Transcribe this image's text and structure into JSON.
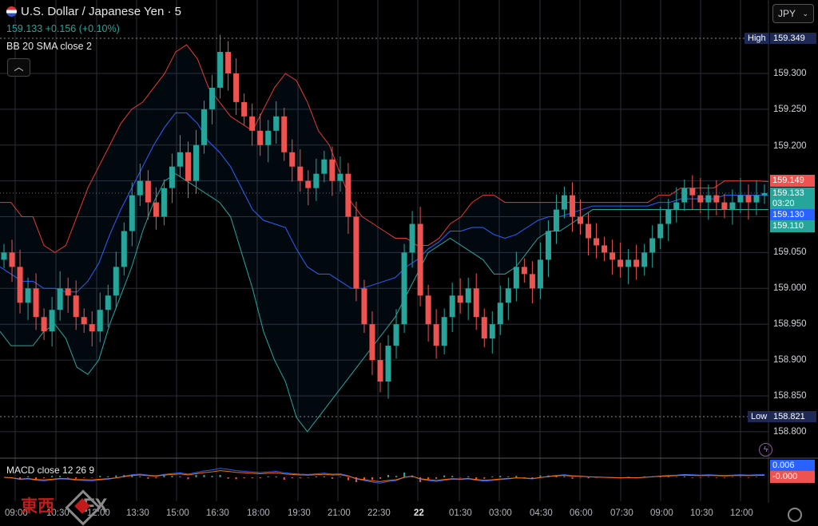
{
  "header": {
    "symbol_title": "U.S. Dollar / Japanese Yen · 5",
    "price_line": "159.133  +0.156 (+0.10%)",
    "indicator": "BB 20 SMA close 2",
    "collapse_icon": "chevron-up-icon"
  },
  "currency_select": {
    "value": "JPY",
    "icon": "chevron-down-icon"
  },
  "price_axis": {
    "labels": [
      "159.300",
      "159.250",
      "159.200",
      "159.050",
      "159.000",
      "158.950",
      "158.900",
      "158.850",
      "158.800"
    ],
    "high": {
      "label": "High",
      "value": "159.349"
    },
    "low": {
      "label": "Low",
      "value": "158.821"
    },
    "bb_upper": "159.149",
    "last_price": "159.133",
    "countdown": "03:20",
    "sma_value": "159.130",
    "bb_lower": "159.110"
  },
  "macd": {
    "label": "MACD close 12 26 9",
    "macd_value": "0.006",
    "signal_value": "-0.000"
  },
  "time_axis": {
    "labels": [
      "09:00",
      "10:30",
      "12:00",
      "13:30",
      "15:00",
      "16:30",
      "18:00",
      "19:30",
      "21:00",
      "22:30",
      "22",
      "01:30",
      "03:00",
      "04:30",
      "06:00",
      "07:30",
      "09:00",
      "10:30",
      "12:00"
    ]
  },
  "watermark": {
    "cn_text": "東西",
    "fx_text": "FX"
  },
  "colors": {
    "up": "#26a69a",
    "down": "#ef5350",
    "bb_upper": "#e53935",
    "bb_lower": "#26a69a",
    "sma": "#2962ff",
    "background": "#000000",
    "grid": "#2a2e39"
  },
  "chart_data": {
    "type": "candlestick",
    "ylim": [
      158.78,
      159.375
    ],
    "series": [
      {
        "name": "close",
        "values": [
          159.05,
          159.03,
          158.98,
          159.0,
          158.96,
          158.94,
          158.97,
          159.0,
          158.99,
          158.96,
          158.95,
          158.94,
          158.97,
          158.99,
          159.03,
          159.08,
          159.13,
          159.15,
          159.12,
          159.1,
          159.14,
          159.17,
          159.19,
          159.15,
          159.2,
          159.25,
          159.28,
          159.33,
          159.3,
          159.26,
          159.24,
          159.22,
          159.2,
          159.22,
          159.24,
          159.19,
          159.17,
          159.15,
          159.14,
          159.16,
          159.18,
          159.15,
          159.16,
          159.1,
          159.0,
          158.95,
          158.9,
          158.87,
          158.92,
          158.95,
          159.05,
          159.09,
          158.99,
          158.95,
          158.92,
          158.96,
          158.99,
          158.98,
          159.0,
          158.96,
          158.93,
          158.95,
          158.98,
          159.0,
          159.03,
          159.02,
          159.0,
          159.04,
          159.08,
          159.11,
          159.13,
          159.1,
          159.09,
          159.07,
          159.06,
          159.05,
          159.04,
          159.03,
          159.04,
          159.03,
          159.05,
          159.07,
          159.09,
          159.11,
          159.12,
          159.14,
          159.13,
          159.12,
          159.13,
          159.12,
          159.11,
          159.12,
          159.13,
          159.12,
          159.13,
          159.133
        ]
      },
      {
        "name": "BB upper",
        "values": [
          159.12,
          159.12,
          159.1,
          159.1,
          159.06,
          159.05,
          159.06,
          159.1,
          159.14,
          159.17,
          159.2,
          159.23,
          159.25,
          159.26,
          159.28,
          159.3,
          159.33,
          159.34,
          159.32,
          159.28,
          159.26,
          159.24,
          159.23,
          159.22,
          159.25,
          159.28,
          159.3,
          159.29,
          159.26,
          159.22,
          159.2,
          159.16,
          159.12,
          159.1,
          159.09,
          159.08,
          159.07,
          159.07,
          159.06,
          159.06,
          159.07,
          159.09,
          159.1,
          159.12,
          159.13,
          159.13,
          159.12,
          159.12,
          159.12,
          159.12,
          159.12,
          159.12,
          159.12,
          159.12,
          159.12,
          159.12,
          159.12,
          159.12,
          159.12,
          159.12,
          159.13,
          159.13,
          159.14,
          159.14,
          159.14,
          159.14,
          159.15,
          159.15,
          159.15,
          159.15,
          159.149
        ]
      },
      {
        "name": "BB lower",
        "values": [
          158.94,
          158.92,
          158.92,
          158.92,
          158.94,
          158.95,
          158.93,
          158.89,
          158.88,
          158.9,
          158.95,
          158.99,
          159.03,
          159.08,
          159.12,
          159.15,
          159.16,
          159.15,
          159.14,
          159.13,
          159.12,
          159.1,
          159.05,
          159.0,
          158.94,
          158.9,
          158.87,
          158.82,
          158.8,
          158.82,
          158.84,
          158.86,
          158.88,
          158.9,
          158.92,
          158.94,
          158.96,
          158.99,
          159.02,
          159.05,
          159.06,
          159.07,
          159.06,
          159.05,
          159.04,
          159.02,
          159.02,
          159.03,
          159.05,
          159.07,
          159.08,
          159.08,
          159.09,
          159.1,
          159.11,
          159.11,
          159.11,
          159.11,
          159.11,
          159.11,
          159.11,
          159.11,
          159.11,
          159.11,
          159.11,
          159.11,
          159.11,
          159.11,
          159.11,
          159.11,
          159.11
        ]
      }
    ]
  }
}
